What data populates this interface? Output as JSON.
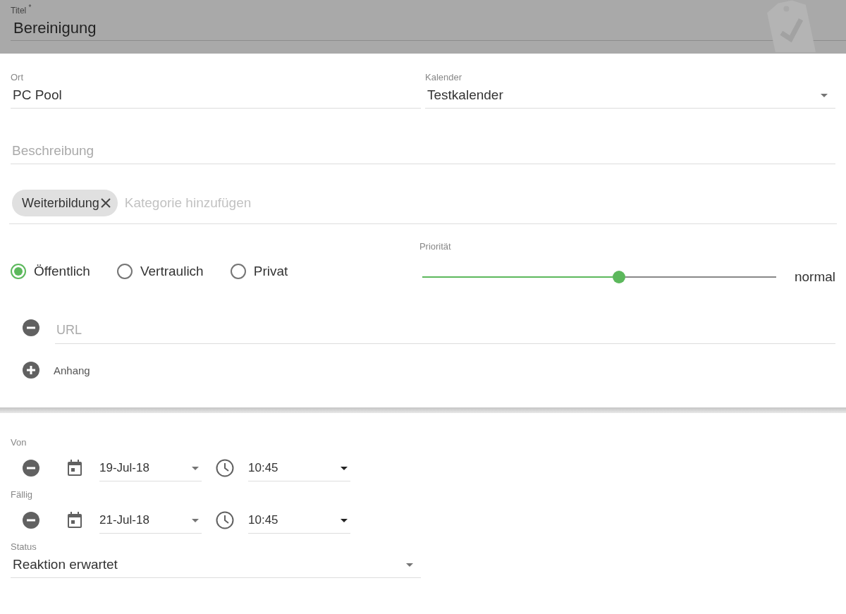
{
  "header": {
    "title_label": "Titel $^{*}$",
    "title_value": "Bereinigung"
  },
  "location": {
    "label": "Ort",
    "value": "PC Pool"
  },
  "calendar": {
    "label": "Kalender",
    "value": "Testkalender"
  },
  "description": {
    "placeholder": "Beschreibung"
  },
  "categories": {
    "chips": [
      {
        "label": "Weiterbildung"
      }
    ],
    "placeholder": "Kategorie hinzufügen"
  },
  "visibility": [
    {
      "label": "Öffentlich",
      "selected": true
    },
    {
      "label": "Vertraulich",
      "selected": false
    },
    {
      "label": "Privat",
      "selected": false
    }
  ],
  "priority": {
    "label": "Priorität",
    "level": 0.555,
    "reading": "normal"
  },
  "url": {
    "placeholder": "URL"
  },
  "attachment": {
    "label": "Anhang"
  },
  "dates": [
    {
      "label": "Von",
      "date": "19-Jul-18",
      "time": "10:45"
    },
    {
      "label": "Fällig",
      "date": "21-Jul-18",
      "time": "10:45"
    }
  ],
  "status": {
    "label": "Status",
    "value": "Reaktion erwartet"
  }
}
